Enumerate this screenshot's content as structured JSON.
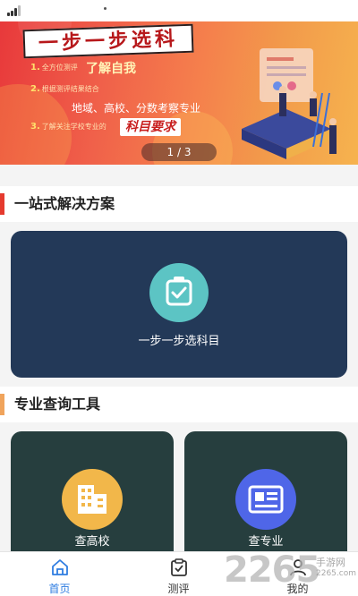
{
  "banner": {
    "title": "一步一步选科",
    "line1_num": "1.",
    "line1_small": "全方位测评",
    "line1_big": "了解自我",
    "line2_num": "2.",
    "line2_small": "根据测评结果结合",
    "line2_mid": "地域、高校、分数考察专业",
    "line3_num": "3.",
    "line3_small": "了解关注学校专业的",
    "line3_tag": "科目要求",
    "pager": "1 / 3"
  },
  "section1": {
    "title": "一站式解决方案",
    "accent": "#e53a2e"
  },
  "main_card": {
    "label": "一步一步选科目",
    "icon": "clipboard-check-icon",
    "color": "#233958",
    "icon_color": "#5cc4c4"
  },
  "section2": {
    "title": "专业查询工具",
    "accent": "#f0a45c"
  },
  "tools": [
    {
      "label": "查高校",
      "icon": "building-icon",
      "icon_color": "#f2b74a"
    },
    {
      "label": "查专业",
      "icon": "newspaper-icon",
      "icon_color": "#4f66e8"
    }
  ],
  "tabbar": {
    "items": [
      {
        "label": "首页",
        "icon": "home-icon",
        "active": true
      },
      {
        "label": "测评",
        "icon": "clipboard-icon",
        "active": false
      },
      {
        "label": "我的",
        "icon": "user-icon",
        "active": false
      }
    ],
    "active_color": "#2f7de1"
  },
  "watermark": {
    "number": "2265",
    "text": "手游网",
    "url": "2265.com"
  }
}
